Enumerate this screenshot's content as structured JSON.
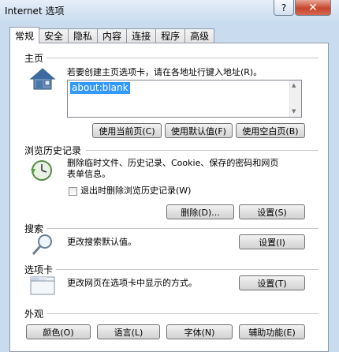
{
  "window": {
    "title": "Internet 选项",
    "help_label": "?",
    "close_label": "✕"
  },
  "tabs": [
    {
      "label": "常规",
      "active": true
    },
    {
      "label": "安全"
    },
    {
      "label": "隐私"
    },
    {
      "label": "内容"
    },
    {
      "label": "连接"
    },
    {
      "label": "程序"
    },
    {
      "label": "高级"
    }
  ],
  "homepage": {
    "group_label": "主页",
    "instruction": "若要创建主页选项卡，请在各地址行键入地址(R)。",
    "url_value": "about:blank",
    "buttons": {
      "use_current": "使用当前页(C)",
      "use_default": "使用默认值(F)",
      "use_blank": "使用空白页(B)"
    }
  },
  "history": {
    "group_label": "浏览历史记录",
    "description_line1": "删除临时文件、历史记录、Cookie、保存的密码和网页",
    "description_line2": "表单信息。",
    "checkbox_label": "退出时删除浏览历史记录(W)",
    "checkbox_checked": false,
    "delete_button": "删除(D)...",
    "settings_button": "设置(S)"
  },
  "search": {
    "group_label": "搜索",
    "description": "更改搜索默认值。",
    "settings_button": "设置(I)"
  },
  "tabsgroup": {
    "group_label": "选项卡",
    "description": "更改网页在选项卡中显示的方式。",
    "settings_button": "设置(T)"
  },
  "appearance": {
    "group_label": "外观",
    "colors_button": "颜色(O)",
    "languages_button": "语言(L)",
    "fonts_button": "字体(N)",
    "accessibility_button": "辅助功能(E)"
  },
  "icons": {
    "homepage": "house-icon",
    "history": "history-clock-icon",
    "search": "magnifier-icon",
    "tabs": "tabs-window-icon"
  }
}
